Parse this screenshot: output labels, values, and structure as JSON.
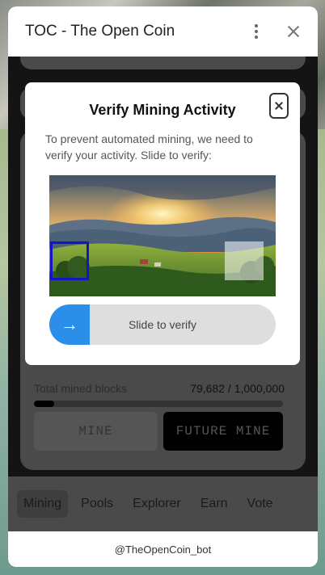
{
  "window": {
    "title": "TOC - The Open Coin"
  },
  "stats": {
    "mined_label": "Total mined blocks",
    "mined_value": "79,682 / 1,000,000",
    "mined_fraction": 0.08
  },
  "buttons": {
    "mine": "MINE",
    "future_mine": "FUTURE MINE"
  },
  "nav": {
    "items": [
      "Mining",
      "Pools",
      "Explorer",
      "Earn",
      "Vote"
    ],
    "active": "Mining"
  },
  "footer": {
    "bot": "@TheOpenCoin_bot"
  },
  "modal": {
    "title": "Verify Mining Activity",
    "description": "To prevent automated mining, we need to verify your activity. Slide to verify:",
    "slider_arrow": "→",
    "slider_label": "Slide to verify"
  },
  "colors": {
    "accent": "#2b8ee8",
    "piece_border": "#1515c8"
  },
  "icons": [
    "kebab-menu-icon",
    "close-icon",
    "arrow-right-icon"
  ]
}
